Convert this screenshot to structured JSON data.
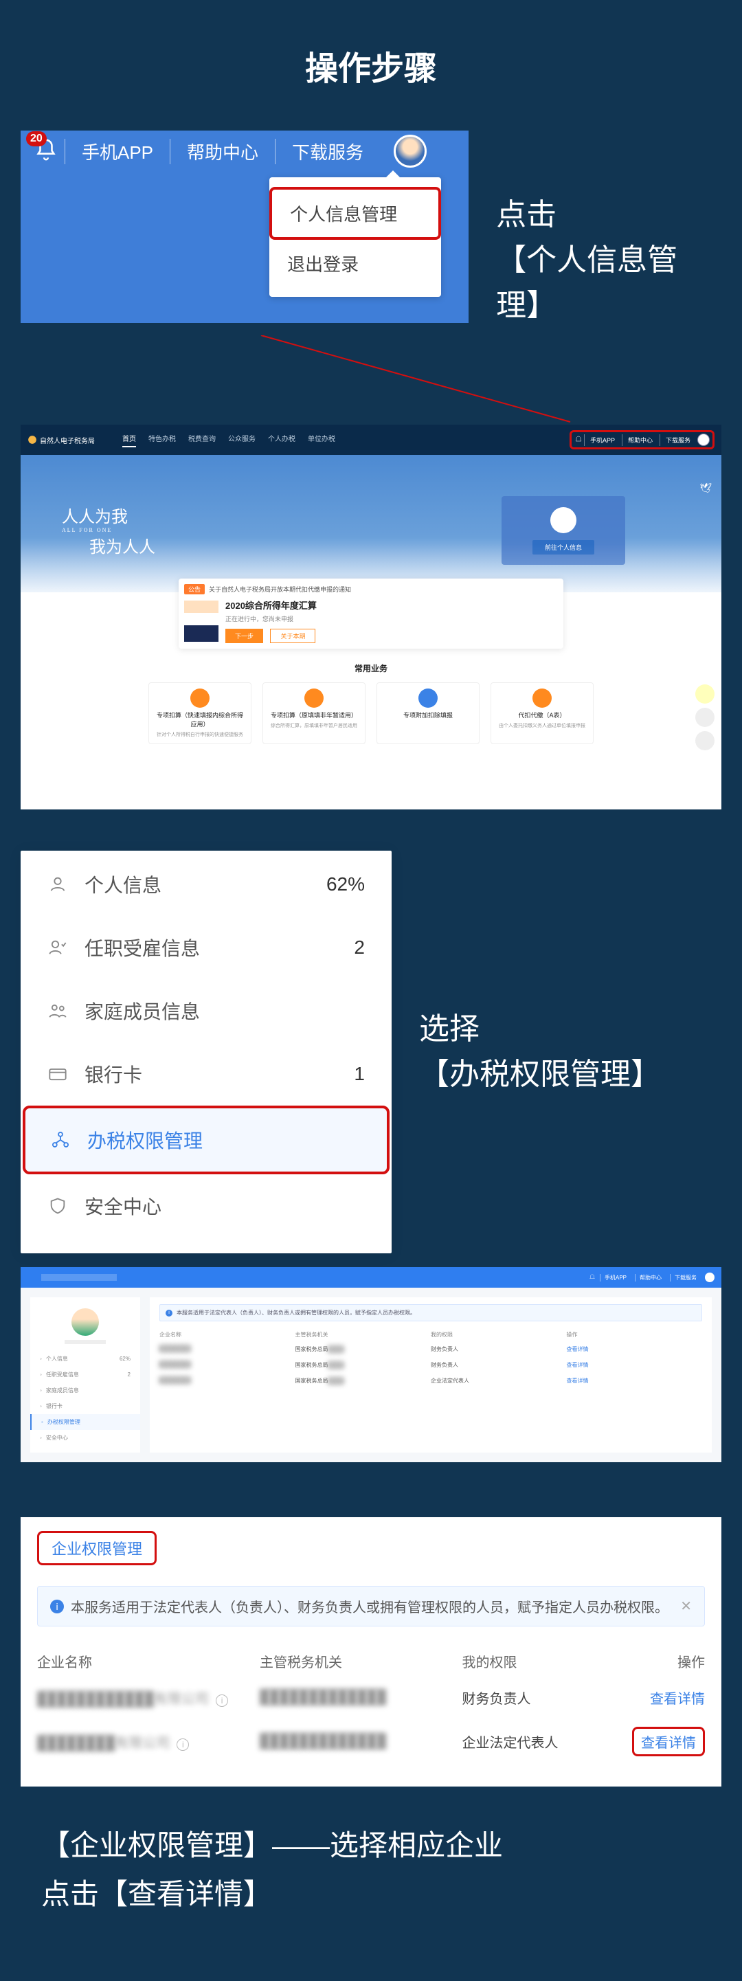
{
  "page_title": "操作步骤",
  "step1": {
    "badge": "20",
    "nav": {
      "app": "手机APP",
      "help": "帮助中心",
      "download": "下载服务"
    },
    "dropdown": {
      "profile": "个人信息管理",
      "logout": "退出登录"
    },
    "instruction_line1": "点击",
    "instruction_line2": "【个人信息管理】"
  },
  "fullsite": {
    "logo": "自然人电子税务局",
    "nav": [
      "首页",
      "特色办税",
      "税费查询",
      "公众服务",
      "个人办税",
      "单位办税"
    ],
    "top_right": [
      "手机APP",
      "帮助中心",
      "下载服务"
    ],
    "dropdown": [
      "个人信息管理",
      "退出登录"
    ],
    "hero_script_1": "人人为我",
    "hero_script_sub": "ALL FOR ONE",
    "hero_script_2": "我为人人",
    "hero_btn": "前往个人信息",
    "notice_banner": "关于自然人电子税务局开放本期代扣代缴申报的通知",
    "notice_tag": "公告",
    "huisuan_title": "2020综合所得年度汇算",
    "huisuan_sub": "正在进行中，您尚未申报",
    "btn_primary": "下一步",
    "btn_secondary": "关于本期",
    "section_title": "常用业务",
    "cards": [
      {
        "t": "专项扣算（快速填报内综合所得应用）",
        "s": "针对个人所得税自行申报的快速便捷服务"
      },
      {
        "t": "专项扣算（原填填非年暂适用）",
        "s": "综合所得汇算，原填填非年暂户居民适用"
      },
      {
        "t": "专项附加扣除填报",
        "s": ""
      },
      {
        "t": "代扣代缴（A表）",
        "s": "由个人委托扣缴义务人通过单位填报申报"
      }
    ]
  },
  "step2": {
    "items": [
      {
        "label": "个人信息",
        "value": "62%"
      },
      {
        "label": "任职受雇信息",
        "value": "2"
      },
      {
        "label": "家庭成员信息",
        "value": ""
      },
      {
        "label": "银行卡",
        "value": "1"
      },
      {
        "label": "办税权限管理",
        "value": ""
      },
      {
        "label": "安全中心",
        "value": ""
      }
    ],
    "instruction_line1": "选择",
    "instruction_line2": "【办税权限管理】"
  },
  "mgmt": {
    "top_links": [
      "手机APP",
      "帮助中心",
      "下载服务"
    ],
    "side": [
      {
        "label": "个人信息",
        "val": "62%"
      },
      {
        "label": "任职受雇信息",
        "val": "2"
      },
      {
        "label": "家庭成员信息",
        "val": ""
      },
      {
        "label": "银行卡",
        "val": ""
      },
      {
        "label": "办税权限管理",
        "val": ""
      },
      {
        "label": "安全中心",
        "val": ""
      }
    ],
    "info": "本服务适用于法定代表人（负责人）、财务负责人或拥有管理权限的人员，赋予指定人员办税权限。",
    "th": [
      "企业名称",
      "主管税务机关",
      "我的权限",
      "操作"
    ],
    "rows": [
      {
        "role": "国家税务总局",
        "perm": "财务负责人",
        "op": "查看详情"
      },
      {
        "role": "国家税务总局",
        "perm": "财务负责人",
        "op": "查看详情"
      },
      {
        "role": "国家税务总局",
        "perm": "企业法定代表人",
        "op": "查看详情"
      }
    ]
  },
  "eperm": {
    "title": "企业权限管理",
    "alert": "本服务适用于法定代表人（负责人）、财务负责人或拥有管理权限的人员，赋予指定人员办税权限。",
    "th": {
      "c1": "企业名称",
      "c2": "主管税务机关",
      "c3": "我的权限",
      "c4": "操作"
    },
    "rows": [
      {
        "name": "████████████有限公司",
        "org": "█████████████",
        "perm": "财务负责人",
        "op": "查看详情"
      },
      {
        "name": "████████有限公司",
        "org": "█████████████",
        "perm": "企业法定代表人",
        "op": "查看详情"
      }
    ]
  },
  "final": {
    "line1": "【企业权限管理】——选择相应企业",
    "line2": "点击【查看详情】"
  }
}
